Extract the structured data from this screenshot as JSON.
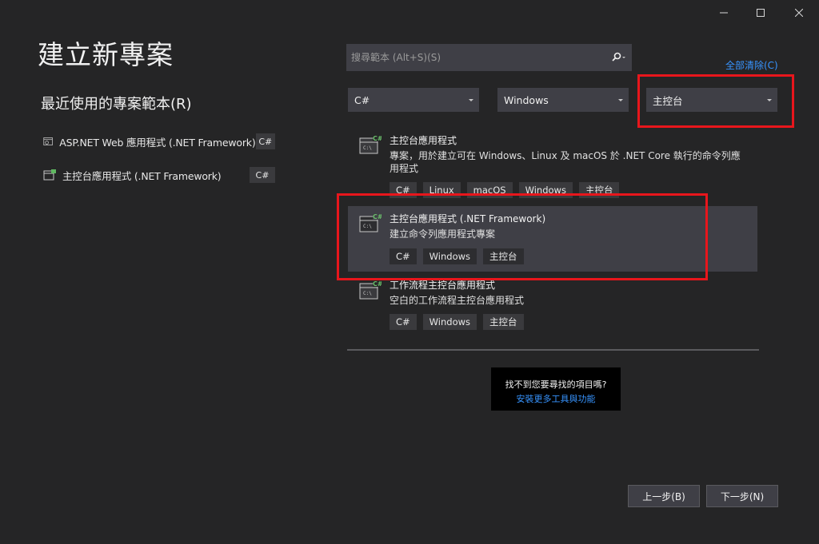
{
  "page": {
    "title": "建立新專案",
    "recent_heading": "最近使用的專案範本(R)"
  },
  "recent": [
    {
      "label": "ASP.NET Web 應用程式 (.NET Framework)",
      "lang": "C#",
      "icon": "web-app-icon"
    },
    {
      "label": "主控台應用程式 (.NET Framework)",
      "lang": "C#",
      "icon": "console-app-icon"
    }
  ],
  "search": {
    "placeholder": "搜尋範本 (Alt+S)(S)",
    "icon": "search-icon"
  },
  "clear_all": "全部清除(C)",
  "filters": {
    "language": "C#",
    "platform": "Windows",
    "project_type": "主控台"
  },
  "templates": [
    {
      "name": "主控台應用程式",
      "desc": "專案，用於建立可在 Windows、Linux 及 macOS 於 .NET Core 執行的命令列應用程式",
      "tags": [
        "C#",
        "Linux",
        "macOS",
        "Windows",
        "主控台"
      ],
      "selected": false
    },
    {
      "name": "主控台應用程式 (.NET Framework)",
      "desc": "建立命令列應用程式專案",
      "tags": [
        "C#",
        "Windows",
        "主控台"
      ],
      "selected": true
    },
    {
      "name": "工作流程主控台應用程式",
      "desc": "空白的工作流程主控台應用程式",
      "tags": [
        "C#",
        "Windows",
        "主控台"
      ],
      "selected": false
    }
  ],
  "not_found": {
    "question": "找不到您要尋找的項目嗎?",
    "link": "安裝更多工具與功能"
  },
  "buttons": {
    "back": "上一步(B)",
    "next": "下一步(N)"
  },
  "colors": {
    "background": "#252526",
    "panel": "#3f3f46",
    "accent_link": "#3794ff",
    "highlight_border": "#e8161c"
  }
}
